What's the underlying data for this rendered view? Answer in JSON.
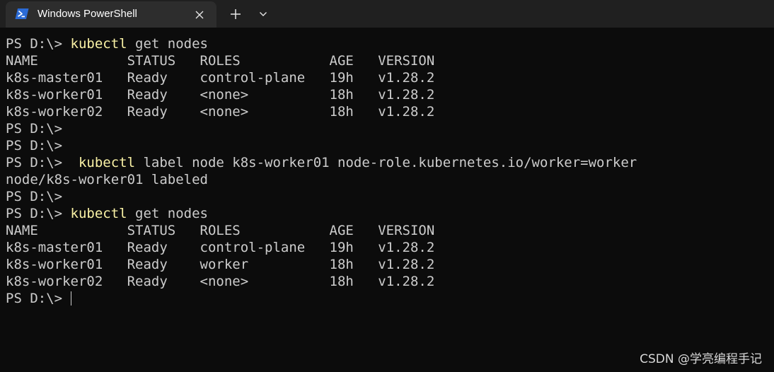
{
  "tab": {
    "title": "Windows PowerShell",
    "icon": "powershell-icon",
    "close_icon": "close-icon"
  },
  "titlebar": {
    "new_tab_icon": "plus-icon",
    "dropdown_icon": "chevron-down-icon"
  },
  "terminal": {
    "lines": [
      {
        "prompt": "PS D:\\> ",
        "cmd": "kubectl",
        "rest": " get nodes"
      },
      {
        "prompt": "",
        "cmd": "",
        "rest": "NAME           STATUS   ROLES           AGE   VERSION"
      },
      {
        "prompt": "",
        "cmd": "",
        "rest": "k8s-master01   Ready    control-plane   19h   v1.28.2"
      },
      {
        "prompt": "",
        "cmd": "",
        "rest": "k8s-worker01   Ready    <none>          18h   v1.28.2"
      },
      {
        "prompt": "",
        "cmd": "",
        "rest": "k8s-worker02   Ready    <none>          18h   v1.28.2"
      },
      {
        "prompt": "PS D:\\>",
        "cmd": "",
        "rest": ""
      },
      {
        "prompt": "PS D:\\>",
        "cmd": "",
        "rest": ""
      },
      {
        "prompt": "PS D:\\>  ",
        "cmd": "kubectl",
        "rest": " label node k8s-worker01 node-role.kubernetes.io/worker=worker"
      },
      {
        "prompt": "",
        "cmd": "",
        "rest": "node/k8s-worker01 labeled"
      },
      {
        "prompt": "PS D:\\>",
        "cmd": "",
        "rest": ""
      },
      {
        "prompt": "PS D:\\> ",
        "cmd": "kubectl",
        "rest": " get nodes"
      },
      {
        "prompt": "",
        "cmd": "",
        "rest": "NAME           STATUS   ROLES           AGE   VERSION"
      },
      {
        "prompt": "",
        "cmd": "",
        "rest": "k8s-master01   Ready    control-plane   19h   v1.28.2"
      },
      {
        "prompt": "",
        "cmd": "",
        "rest": "k8s-worker01   Ready    worker          18h   v1.28.2"
      },
      {
        "prompt": "",
        "cmd": "",
        "rest": "k8s-worker02   Ready    <none>          18h   v1.28.2"
      },
      {
        "prompt": "PS D:\\> ",
        "cmd": "",
        "rest": ""
      }
    ]
  },
  "watermark": "CSDN @学亮编程手记",
  "colors": {
    "background": "#0c0c0c",
    "titlebar": "#202020",
    "tab": "#2d2d2d",
    "text": "#cccccc",
    "command": "#f9f1a5",
    "powershell_icon": "#2b6bd6"
  }
}
